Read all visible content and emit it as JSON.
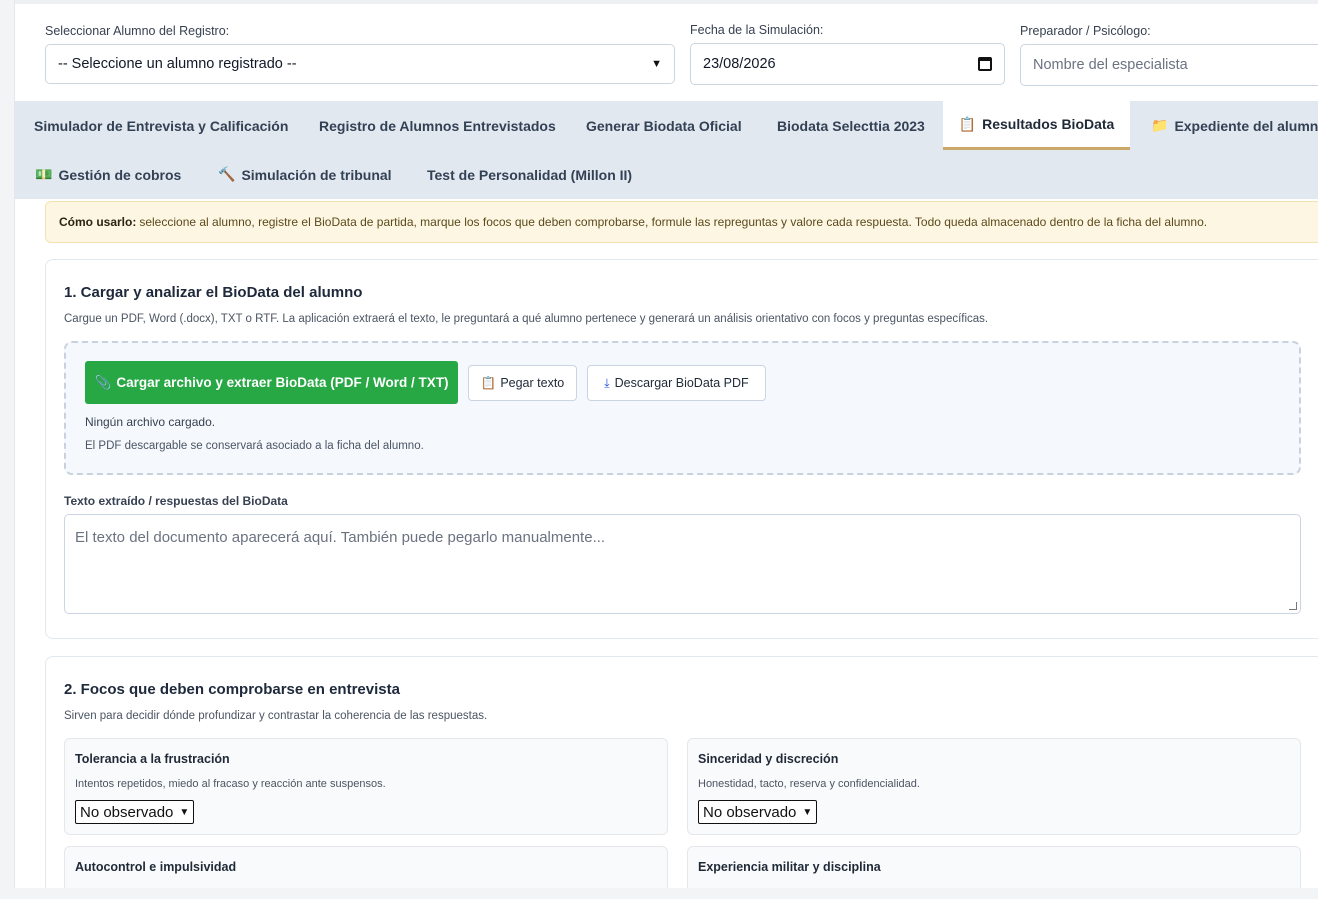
{
  "header": {
    "student_label": "Seleccionar Alumno del Registro:",
    "student_value": "-- Seleccione un alumno registrado --",
    "date_label": "Fecha de la Simulación:",
    "date_value": "23/08/2026",
    "preparer_label": "Preparador / Psicólogo:",
    "preparer_placeholder": "Nombre del especialista"
  },
  "tabs": [
    {
      "label": "Simulador de Entrevista y Calificación",
      "icon": ""
    },
    {
      "label": "Registro de Alumnos Entrevistados",
      "icon": ""
    },
    {
      "label": "Generar Biodata Oficial",
      "icon": ""
    },
    {
      "label": "Biodata Selecttia 2023",
      "icon": ""
    },
    {
      "label": "Resultados BioData",
      "icon": "📋"
    },
    {
      "label": "Expediente del alumno",
      "icon": "📁"
    },
    {
      "label": "Gestión de cobros",
      "icon": "💵"
    },
    {
      "label": "Simulación de tribunal",
      "icon": "🔨"
    },
    {
      "label": "Test de Personalidad (Millon II)",
      "icon": ""
    }
  ],
  "notice": {
    "bold": "Cómo usarlo:",
    "text": "seleccione al alumno, registre el BioData de partida, marque los focos que deben comprobarse, formule las repreguntas y valore cada respuesta. Todo queda almacenado dentro de la ficha del alumno."
  },
  "section1": {
    "title": "1. Cargar y analizar el BioData del alumno",
    "subtitle": "Cargue un PDF, Word (.docx), TXT o RTF. La aplicación extraerá el texto, le preguntará a qué alumno pertenece y generará un análisis orientativo con focos y preguntas específicas.",
    "upload_button": "Cargar archivo y extraer BioData (PDF / Word / TXT)",
    "paste_button": "Pegar texto",
    "download_button": "Descargar BioData PDF",
    "file_status": "Ningún archivo cargado.",
    "file_note": "El PDF descargable se conservará asociado a la ficha del alumno.",
    "textarea_label": "Texto extraído / respuestas del BioData",
    "textarea_placeholder": "El texto del documento aparecerá aquí. También puede pegarlo manualmente..."
  },
  "section2": {
    "title": "2. Focos que deben comprobarse en entrevista",
    "subtitle": "Sirven para decidir dónde profundizar y contrastar la coherencia de las respuestas.",
    "focuses": [
      {
        "title": "Tolerancia a la frustración",
        "desc": "Intentos repetidos, miedo al fracaso y reacción ante suspensos.",
        "value": "No observado"
      },
      {
        "title": "Sinceridad y discreción",
        "desc": "Honestidad, tacto, reserva y confidencialidad.",
        "value": "No observado"
      },
      {
        "title": "Autocontrol e impulsividad",
        "desc": "",
        "value": ""
      },
      {
        "title": "Experiencia militar y disciplina",
        "desc": "",
        "value": ""
      }
    ]
  }
}
